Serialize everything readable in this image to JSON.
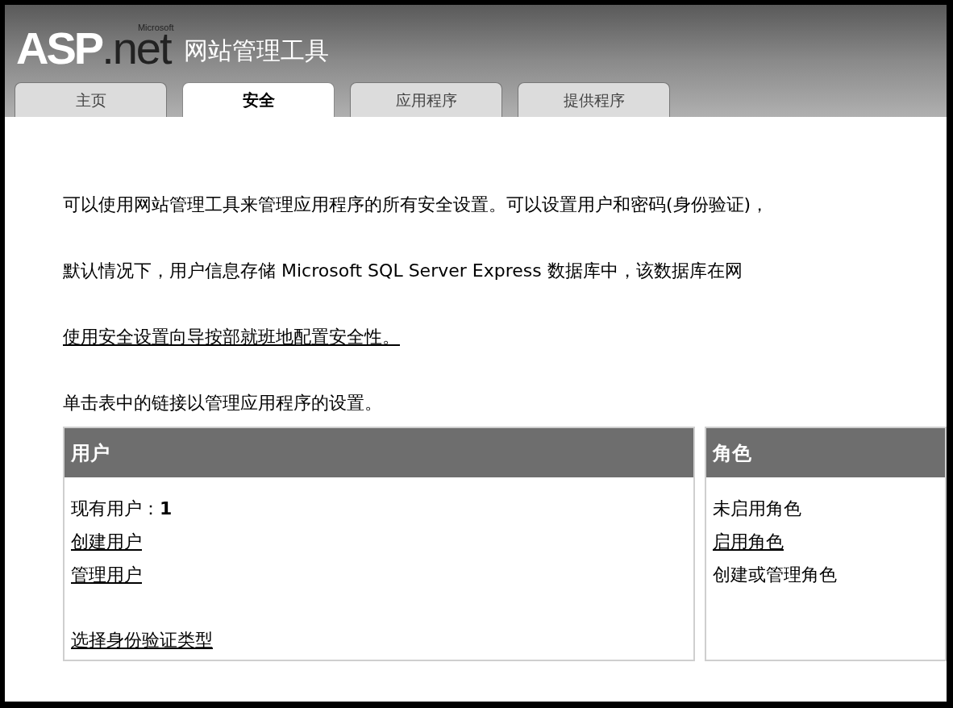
{
  "logo": {
    "brand": "ASP",
    "suffix": ".net",
    "superscript": "Microsoft"
  },
  "header": {
    "title": "网站管理工具"
  },
  "tabs": [
    {
      "label": "主页",
      "selected": false
    },
    {
      "label": "安全",
      "selected": true
    },
    {
      "label": "应用程序",
      "selected": false
    },
    {
      "label": "提供程序",
      "selected": false
    }
  ],
  "paragraphs": [
    {
      "kind": "text",
      "text": "可以使用网站管理工具来管理应用程序的所有安全设置。可以设置用户和密码(身份验证)，"
    },
    {
      "kind": "text",
      "text": "默认情况下，用户信息存储 Microsoft SQL Server Express 数据库中，该数据库在网"
    },
    {
      "kind": "link",
      "text": "使用安全设置向导按部就班地配置安全性。"
    },
    {
      "kind": "text",
      "text": "单击表中的链接以管理应用程序的设置。"
    }
  ],
  "panels": [
    {
      "title": "用户",
      "items": [
        {
          "kind": "text",
          "text": "现有用户：**1**"
        },
        {
          "kind": "link",
          "text": "创建用户"
        },
        {
          "kind": "link",
          "text": "管理用户"
        },
        {
          "kind": "gap"
        },
        {
          "kind": "link",
          "text": "选择身份验证类型"
        }
      ]
    },
    {
      "title": "角色",
      "items": [
        {
          "kind": "text",
          "text": "未启用角色"
        },
        {
          "kind": "link",
          "text": "启用角色"
        },
        {
          "kind": "text",
          "text": "创建或管理角色"
        }
      ]
    }
  ]
}
